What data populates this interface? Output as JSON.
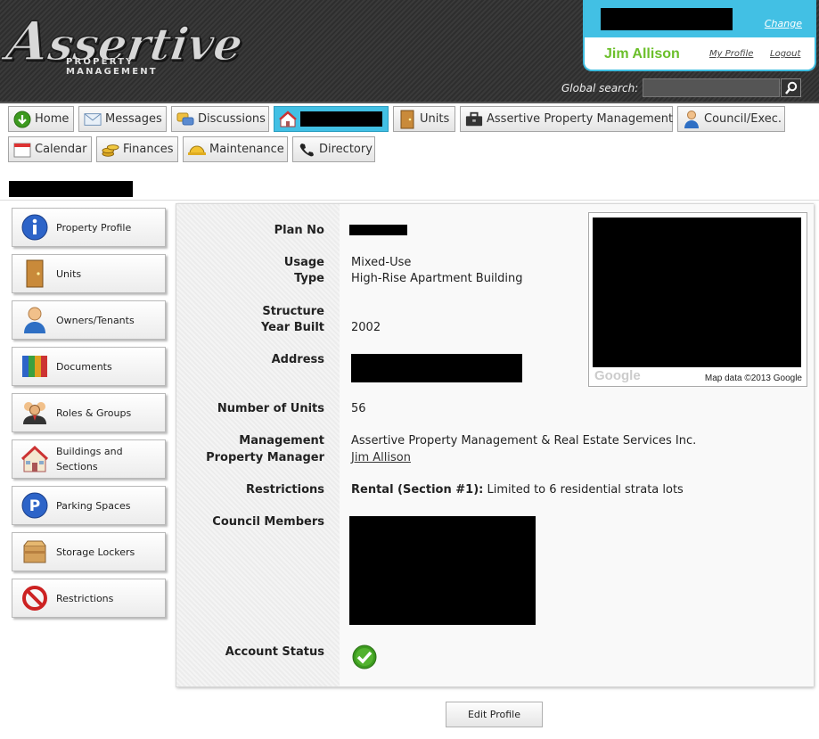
{
  "header": {
    "logo_text": "Assertive",
    "logo_sub": "PROPERTY MANAGEMENT",
    "user_name": "Jim Allison",
    "change_label": "Change",
    "my_profile_label": "My Profile",
    "logout_label": "Logout",
    "global_search_label": "Global search:",
    "global_search_value": ""
  },
  "tabs": [
    {
      "label": "Home",
      "icon": "home-icon"
    },
    {
      "label": "Messages",
      "icon": "envelope-icon"
    },
    {
      "label": "Discussions",
      "icon": "discussions-icon"
    },
    {
      "label": "",
      "icon": "building-icon",
      "redacted": true
    },
    {
      "label": "Units",
      "icon": "door-icon"
    },
    {
      "label": "Assertive Property Management",
      "icon": "briefcase-icon"
    },
    {
      "label": "Council/Exec.",
      "icon": "person-icon"
    },
    {
      "label": "Calendar",
      "icon": "calendar-icon"
    },
    {
      "label": "Finances",
      "icon": "coins-icon"
    },
    {
      "label": "Maintenance",
      "icon": "hardhat-icon"
    },
    {
      "label": "Directory",
      "icon": "phone-icon"
    }
  ],
  "sidebar": {
    "items": [
      {
        "label": "Property Profile",
        "icon": "info-icon"
      },
      {
        "label": "Units",
        "icon": "door-icon"
      },
      {
        "label": "Owners/Tenants",
        "icon": "person-icon"
      },
      {
        "label": "Documents",
        "icon": "binders-icon"
      },
      {
        "label": "Roles & Groups",
        "icon": "group-icon"
      },
      {
        "label": "Buildings and Sections",
        "icon": "house-icon"
      },
      {
        "label": "Parking Spaces",
        "icon": "parking-icon"
      },
      {
        "label": "Storage Lockers",
        "icon": "box-icon"
      },
      {
        "label": "Restrictions",
        "icon": "no-entry-icon"
      }
    ]
  },
  "profile": {
    "plan_no_label": "Plan No",
    "usage_label": "Usage",
    "usage_value": "Mixed-Use",
    "type_label": "Type",
    "type_value": "High-Rise Apartment Building",
    "structure_label": "Structure",
    "year_built_label": "Year Built",
    "year_built_value": "2002",
    "address_label": "Address",
    "units_label": "Number of Units",
    "units_value": "56",
    "management_label": "Management",
    "management_value": "Assertive Property Management & Real Estate Services Inc.",
    "pm_label": "Property Manager",
    "pm_value": "Jim Allison",
    "restrictions_label": "Restrictions",
    "restrictions_bold": "Rental (Section #1):",
    "restrictions_value": " Limited to 6 residential strata lots",
    "council_label": "Council Members",
    "account_status_label": "Account Status"
  },
  "map": {
    "google_label": "Google",
    "attribution": "Map data ©2013 Google"
  },
  "edit_profile_label": "Edit Profile",
  "colors": {
    "accent": "#42c0e4",
    "user_name": "#6bbf2a",
    "status_ok": "#3c9a1f"
  }
}
